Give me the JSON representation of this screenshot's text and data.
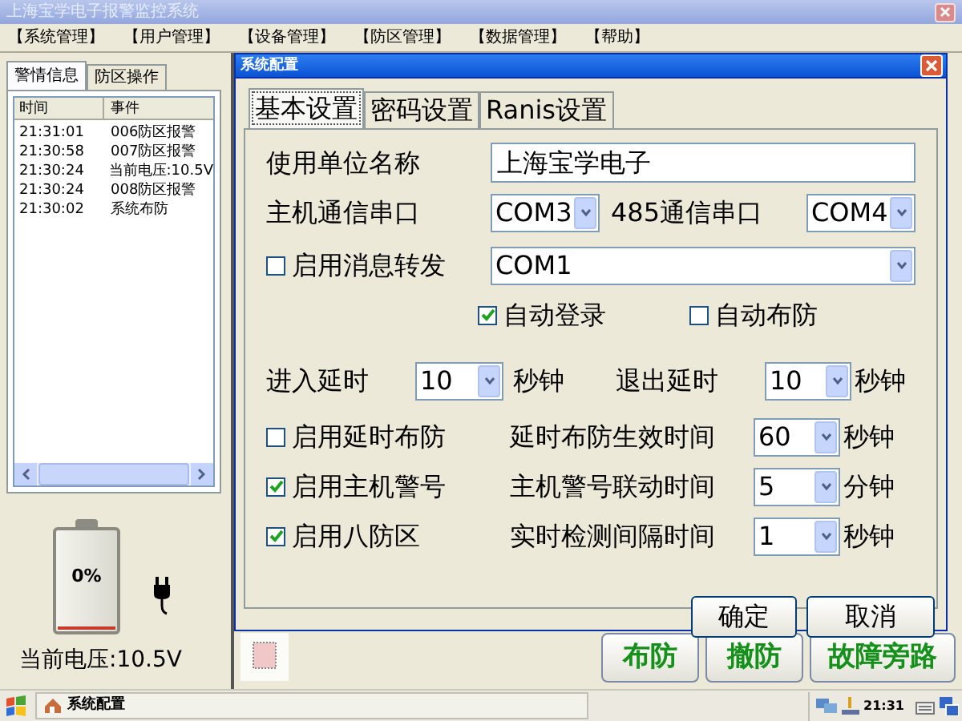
{
  "window": {
    "title": "上海宝学电子报警监控系统"
  },
  "menu": [
    "【系统管理】",
    "【用户管理】",
    "【设备管理】",
    "【防区管理】",
    "【数据管理】",
    "【帮助】"
  ],
  "left_panel": {
    "tabs": [
      {
        "label": "警情信息",
        "selected": true
      },
      {
        "label": "防区操作",
        "selected": false
      }
    ],
    "columns": [
      "时间",
      "事件"
    ],
    "rows": [
      {
        "time": "21:31:01",
        "event": "006防区报警"
      },
      {
        "time": "21:30:58",
        "event": "007防区报警"
      },
      {
        "time": "21:30:24",
        "event": "当前电压:10.5V"
      },
      {
        "time": "21:30:24",
        "event": "008防区报警"
      },
      {
        "time": "21:30:02",
        "event": "系统布防"
      }
    ],
    "battery": {
      "level": 0,
      "reading": "0%"
    },
    "voltage": "当前电压:10.5V"
  },
  "dialog": {
    "title": "系统配置",
    "tabs": [
      {
        "label": "基本设置",
        "selected": true
      },
      {
        "label": "密码设置",
        "selected": false
      },
      {
        "label": "Ranis设置",
        "selected": false
      }
    ],
    "rows": [
      {
        "kind": "text_field",
        "label": "使用单位名称",
        "value": "上海宝学电子"
      },
      {
        "kind": "port_pair",
        "label": "主机通信串口",
        "value": "COM3",
        "label_2": "485通信串口",
        "value_2": "COM4"
      },
      {
        "kind": "check_select",
        "label": "启用消息转发",
        "checked": false,
        "value": "COM1"
      },
      {
        "kind": "check_pair",
        "items": [
          {
            "label": "自动登录",
            "checked": true
          },
          {
            "label": "自动布防",
            "checked": false
          }
        ]
      },
      {
        "kind": "delay_pair",
        "label": "进入延时",
        "value": "10",
        "unit": "秒钟",
        "label_2": "退出延时",
        "value_2": "10",
        "unit_2": "秒钟"
      },
      {
        "kind": "check_timed",
        "label": "启用延时布防",
        "checked": false,
        "time_label": "延时布防生效时间",
        "value": "60",
        "unit": "秒钟"
      },
      {
        "kind": "check_timed",
        "label": "启用主机警号",
        "checked": true,
        "time_label": "主机警号联动时间",
        "value": "5",
        "unit": "分钟"
      },
      {
        "kind": "check_timed",
        "label": "启用八防区",
        "checked": true,
        "time_label": "实时检测间隔时间",
        "value": "1",
        "unit": "秒钟"
      }
    ],
    "buttons": [
      "确定",
      "取消"
    ]
  },
  "actions": [
    "布防",
    "撤防",
    "故障旁路"
  ],
  "taskbar": {
    "task": "系统配置",
    "clock": "21:31"
  }
}
